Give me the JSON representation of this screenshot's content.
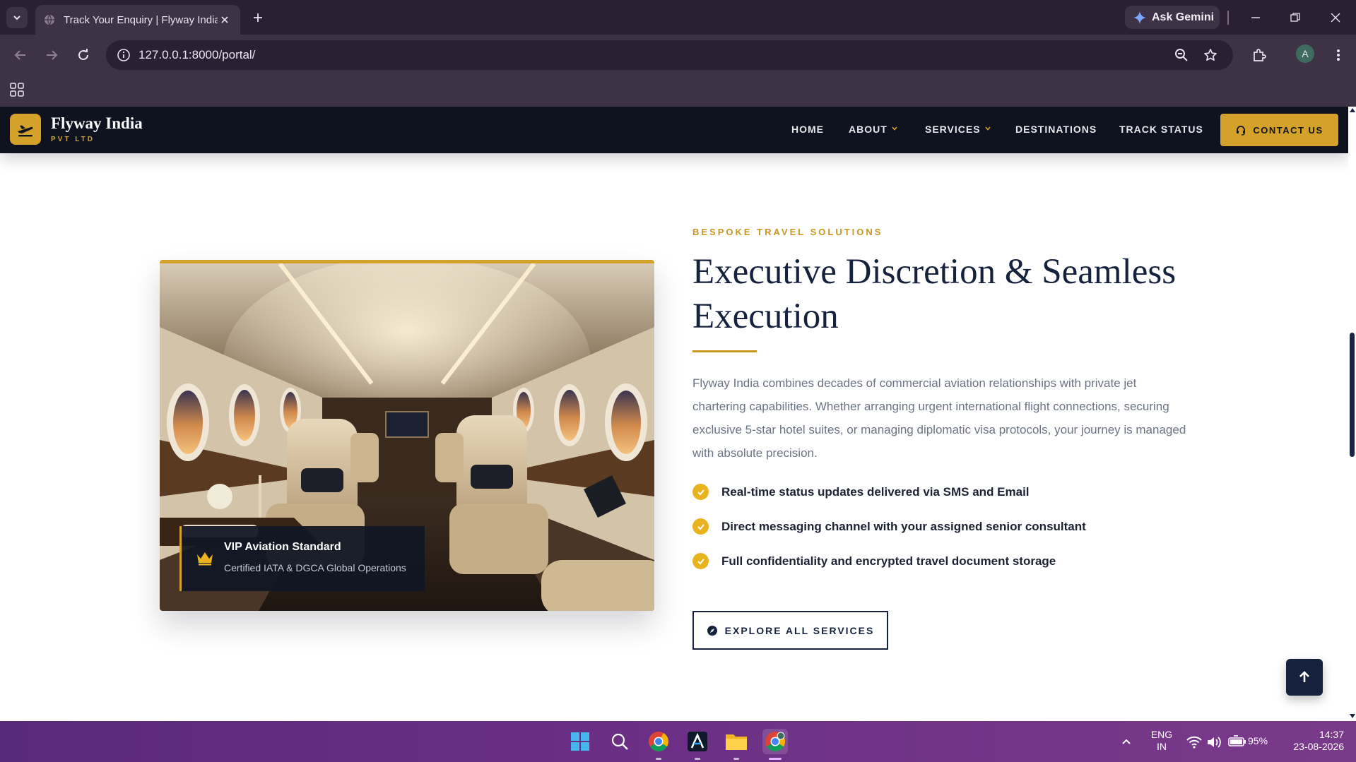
{
  "browser": {
    "tab_title": "Track Your Enquiry | Flyway India",
    "url": "127.0.0.1:8000/portal/",
    "gemini_label": "Ask Gemini",
    "profile_initial": "A"
  },
  "site": {
    "brand_name": "Flyway India",
    "brand_sub": "PVT LTD",
    "nav": [
      {
        "label": "HOME"
      },
      {
        "label": "ABOUT"
      },
      {
        "label": "SERVICES"
      },
      {
        "label": "DESTINATIONS"
      },
      {
        "label": "TRACK STATUS"
      }
    ],
    "contact_label": "CONTACT US",
    "accent_color": "#d4a22a",
    "navy_color": "#16223d"
  },
  "section": {
    "eyebrow": "BESPOKE TRAVEL SOLUTIONS",
    "headline": "Executive Discretion & Seamless Execution",
    "lead": "Flyway India combines decades of commercial aviation relationships with private jet chartering capabilities. Whether arranging urgent international flight connections, securing exclusive 5-star hotel suites, or managing diplomatic visa protocols, your journey is managed with absolute precision.",
    "features": [
      {
        "text": "Real-time status updates delivered via SMS and Email"
      },
      {
        "text": "Direct messaging channel with your assigned senior consultant"
      },
      {
        "text": "Full confidentiality and encrypted travel document storage"
      }
    ],
    "cta_label": "EXPLORE ALL SERVICES",
    "badge_title": "VIP Aviation Standard",
    "badge_sub": "Certified IATA & DGCA Global Operations",
    "image_subject": "private-jet-cabin-interior"
  },
  "taskbar": {
    "lang_top": "ENG",
    "lang_bottom": "IN",
    "battery": "95%",
    "time": "14:37",
    "date": "23-08-2026"
  }
}
